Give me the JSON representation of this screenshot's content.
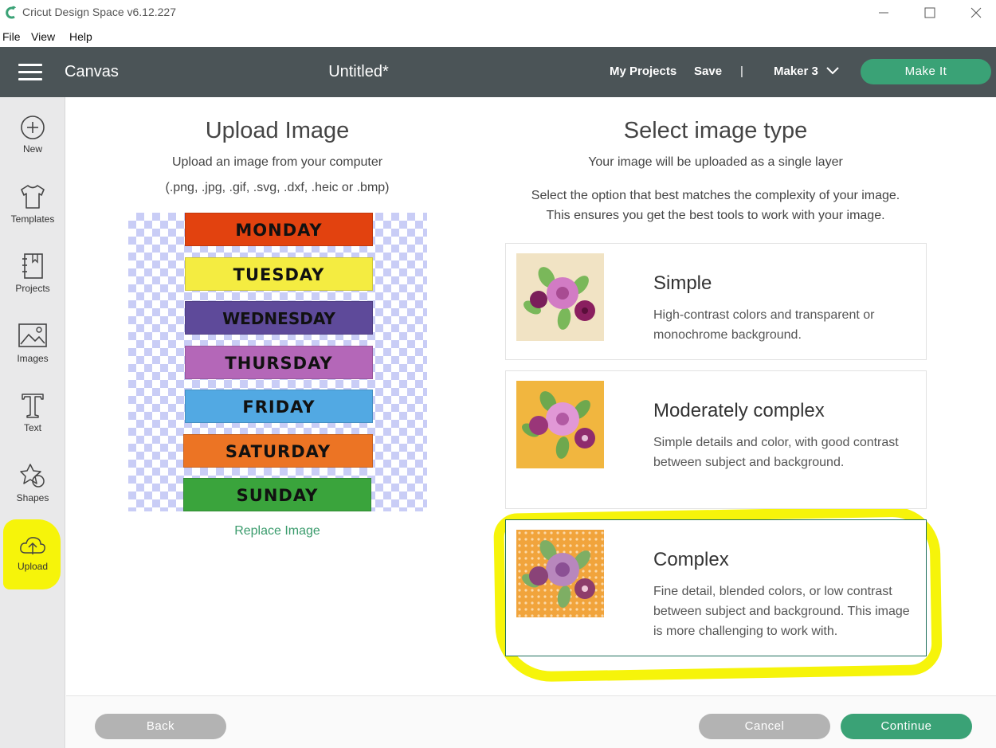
{
  "window": {
    "title": "Cricut Design Space  v6.12.227"
  },
  "menu": [
    "File",
    "View",
    "Help"
  ],
  "header": {
    "section": "Canvas",
    "document_title": "Untitled*",
    "my_projects": "My Projects",
    "save": "Save",
    "separator": "|",
    "machine": "Maker 3",
    "make_it": "Make It"
  },
  "sidebar": {
    "items": [
      {
        "label": "New",
        "icon": "plus-circle-icon"
      },
      {
        "label": "Templates",
        "icon": "shirt-icon"
      },
      {
        "label": "Projects",
        "icon": "notebook-icon"
      },
      {
        "label": "Images",
        "icon": "image-icon"
      },
      {
        "label": "Text",
        "icon": "text-t-icon"
      },
      {
        "label": "Shapes",
        "icon": "shapes-icon"
      },
      {
        "label": "Upload",
        "icon": "cloud-upload-icon"
      }
    ],
    "highlight_color": "#f6f40a"
  },
  "upload": {
    "title": "Upload Image",
    "subtitle": "Upload an image from your computer",
    "formats": "(.png, .jpg, .gif, .svg, .dxf, .heic or .bmp)",
    "replace_link": "Replace Image",
    "preview_days": [
      {
        "label": "MONDAY",
        "color": "#e2420f"
      },
      {
        "label": "TUESDAY",
        "color": "#f4ec41"
      },
      {
        "label": "WEDNESDAY",
        "color": "#5e4a9a"
      },
      {
        "label": "THURSDAY",
        "color": "#b467b8"
      },
      {
        "label": "FRIDAY",
        "color": "#52a9e3"
      },
      {
        "label": "SATURDAY",
        "color": "#ec7424"
      },
      {
        "label": "SUNDAY",
        "color": "#3aa43c"
      }
    ]
  },
  "select_type": {
    "title": "Select image type",
    "subtitle": "Your image will be uploaded as a single layer",
    "instructions_line1": "Select the option that best matches the complexity of your image.",
    "instructions_line2": "This ensures you get the best tools to work with your image.",
    "options": [
      {
        "name": "Simple",
        "description": "High-contrast colors and transparent or monochrome background.",
        "thumb_bg": "#f1e3c4",
        "selected": false
      },
      {
        "name": "Moderately complex",
        "description": "Simple details and color, with good contrast between subject and background.",
        "thumb_bg": "#f1b63f",
        "selected": false
      },
      {
        "name": "Complex",
        "description": "Fine detail, blended colors, or low contrast between subject and background. This image is more challenging to work with.",
        "thumb_bg": "#f1a43c",
        "selected": true
      }
    ]
  },
  "footer": {
    "back": "Back",
    "cancel": "Cancel",
    "continue": "Continue"
  },
  "colors": {
    "header_bg": "#4b5457",
    "accent_green": "#3aa276",
    "highlight_yellow": "#f6f40a",
    "button_gray": "#b3b3b3"
  }
}
